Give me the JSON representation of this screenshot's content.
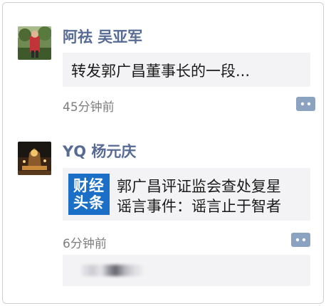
{
  "posts": [
    {
      "author": "阿祛  吴亚军",
      "text": "转发郭广昌董事长的一段...",
      "time": "45分钟前"
    },
    {
      "author": "YQ  杨元庆",
      "link_thumb": [
        "财经",
        "头条"
      ],
      "link_title_line1": "郭广昌评证监会查处复星",
      "link_title_line2": "谣言事件：谣言止于智者",
      "time": "6分钟前"
    }
  ],
  "colors": {
    "name": "#576b95",
    "bubble_bg": "#f3f3f5",
    "thumb_bg": "#1b6fc6",
    "time": "#7d7d7d"
  },
  "icons": {
    "comment_button": "comment-more-icon"
  }
}
